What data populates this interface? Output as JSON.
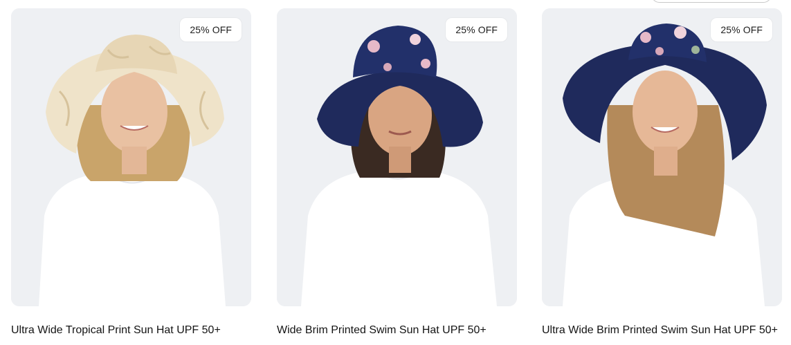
{
  "products": [
    {
      "title": "Ultra Wide Tropical Print Sun Hat UPF 50+",
      "badge": "25% OFF",
      "image_icon": "model-photo-beige-tropical-sun-hat"
    },
    {
      "title": "Wide Brim Printed Swim Sun Hat UPF 50+",
      "badge": "25% OFF",
      "image_icon": "model-photo-navy-floral-swim-hat"
    },
    {
      "title": "Ultra Wide Brim Printed Swim Sun Hat UPF 50+",
      "badge": "25% OFF",
      "image_icon": "model-photo-navy-floral-ultra-wide-hat"
    }
  ],
  "colors": {
    "card_background": "#eef0f3",
    "badge_background": "#ffffff",
    "text": "#141414",
    "navy_hat": "#1f2a5c",
    "beige_hat": "#efe3c9"
  }
}
